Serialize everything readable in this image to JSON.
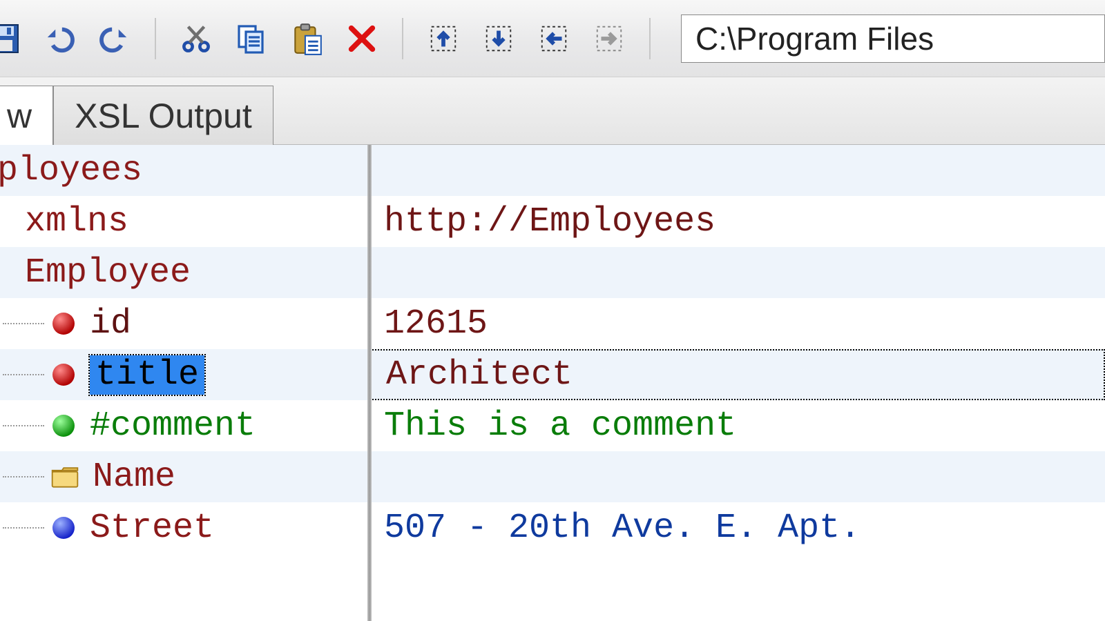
{
  "toolbar": {
    "path_value": "C:\\Program Files"
  },
  "tabs": {
    "partial_left_label": "w",
    "xsl_output_label": "XSL Output"
  },
  "tree": {
    "root_label": "ployees",
    "xmlns": {
      "name": "xmlns",
      "value": "http://Employees"
    },
    "employee": {
      "name": "Employee"
    },
    "id": {
      "name": "id",
      "value": "12615"
    },
    "title": {
      "name": "title",
      "value": "Architect"
    },
    "comment": {
      "name": "#comment",
      "value": "This is a comment"
    },
    "name_el": {
      "name": "Name"
    },
    "street": {
      "name": "Street",
      "value": "507 - 20th Ave. E. Apt."
    }
  }
}
